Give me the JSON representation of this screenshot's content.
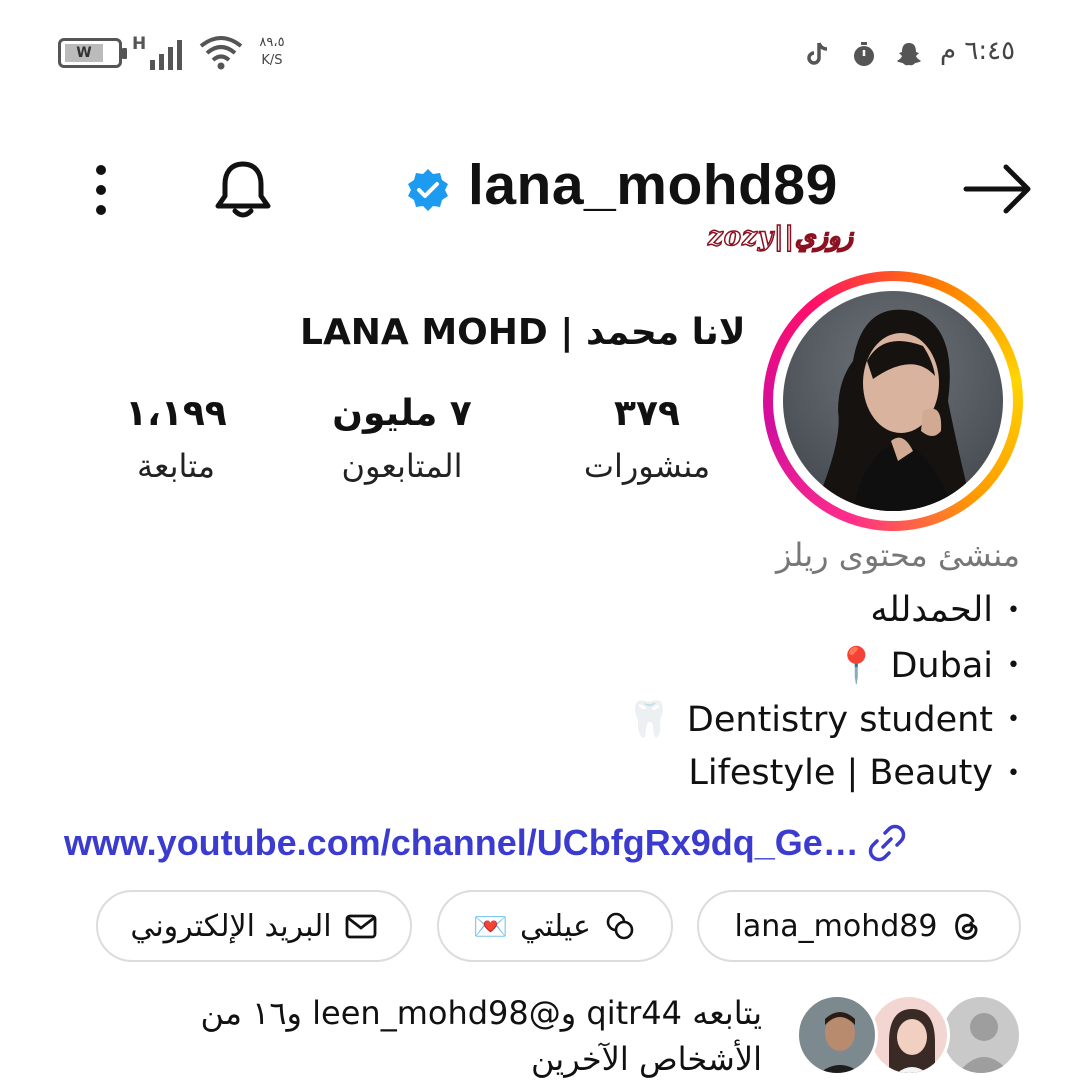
{
  "status_bar": {
    "battery_label": "W",
    "network_type": "H",
    "speed_value": "٨٩،٥",
    "speed_unit": "K/S",
    "time": "٦:٤٥ م",
    "icons": [
      "tiktok-icon",
      "timer-icon",
      "snapchat-icon"
    ]
  },
  "header": {
    "username": "lana_mohd89",
    "watermark": "zozy||زوزي",
    "icons": [
      "more-vertical-icon",
      "bell-icon",
      "verified-badge-icon",
      "arrow-right-icon"
    ]
  },
  "profile": {
    "display_name": "LANA MOHD | لانا محمد",
    "stats": [
      {
        "value": "٣٧٩",
        "label": "منشورات"
      },
      {
        "value": "٧ مليون",
        "label": "المتابعون"
      },
      {
        "value": "١،١٩٩",
        "label": "متابعة"
      }
    ],
    "category": "منشئ محتوى ريلز",
    "bio": [
      {
        "text": "الحمدلله",
        "emoji": ""
      },
      {
        "text": "Dubai",
        "emoji": "📍"
      },
      {
        "text": "Dentistry student",
        "emoji": "🦷"
      },
      {
        "text": "Lifestyle | Beauty",
        "emoji": ""
      }
    ],
    "bio_bullet": "•",
    "link": "www.youtube.com/channel/UCbfgRx9dq_Ge…"
  },
  "pills": [
    {
      "label": "البريد الإلكتروني",
      "icon": "mail-icon"
    },
    {
      "label": "عيلتي",
      "icon": "chat-bubbles-icon",
      "emoji": "💌"
    },
    {
      "label": "lana_mohd89",
      "icon": "threads-icon"
    }
  ],
  "followed_by": {
    "text": "يتابعه qitr44 و@leen_mohd98 و١٦ من الأشخاص الآخرين"
  },
  "colors": {
    "link": "#3b3bd0",
    "verified": "#1d9bf0",
    "ring_start": "#d10f9f",
    "ring_end": "#ffd400"
  }
}
